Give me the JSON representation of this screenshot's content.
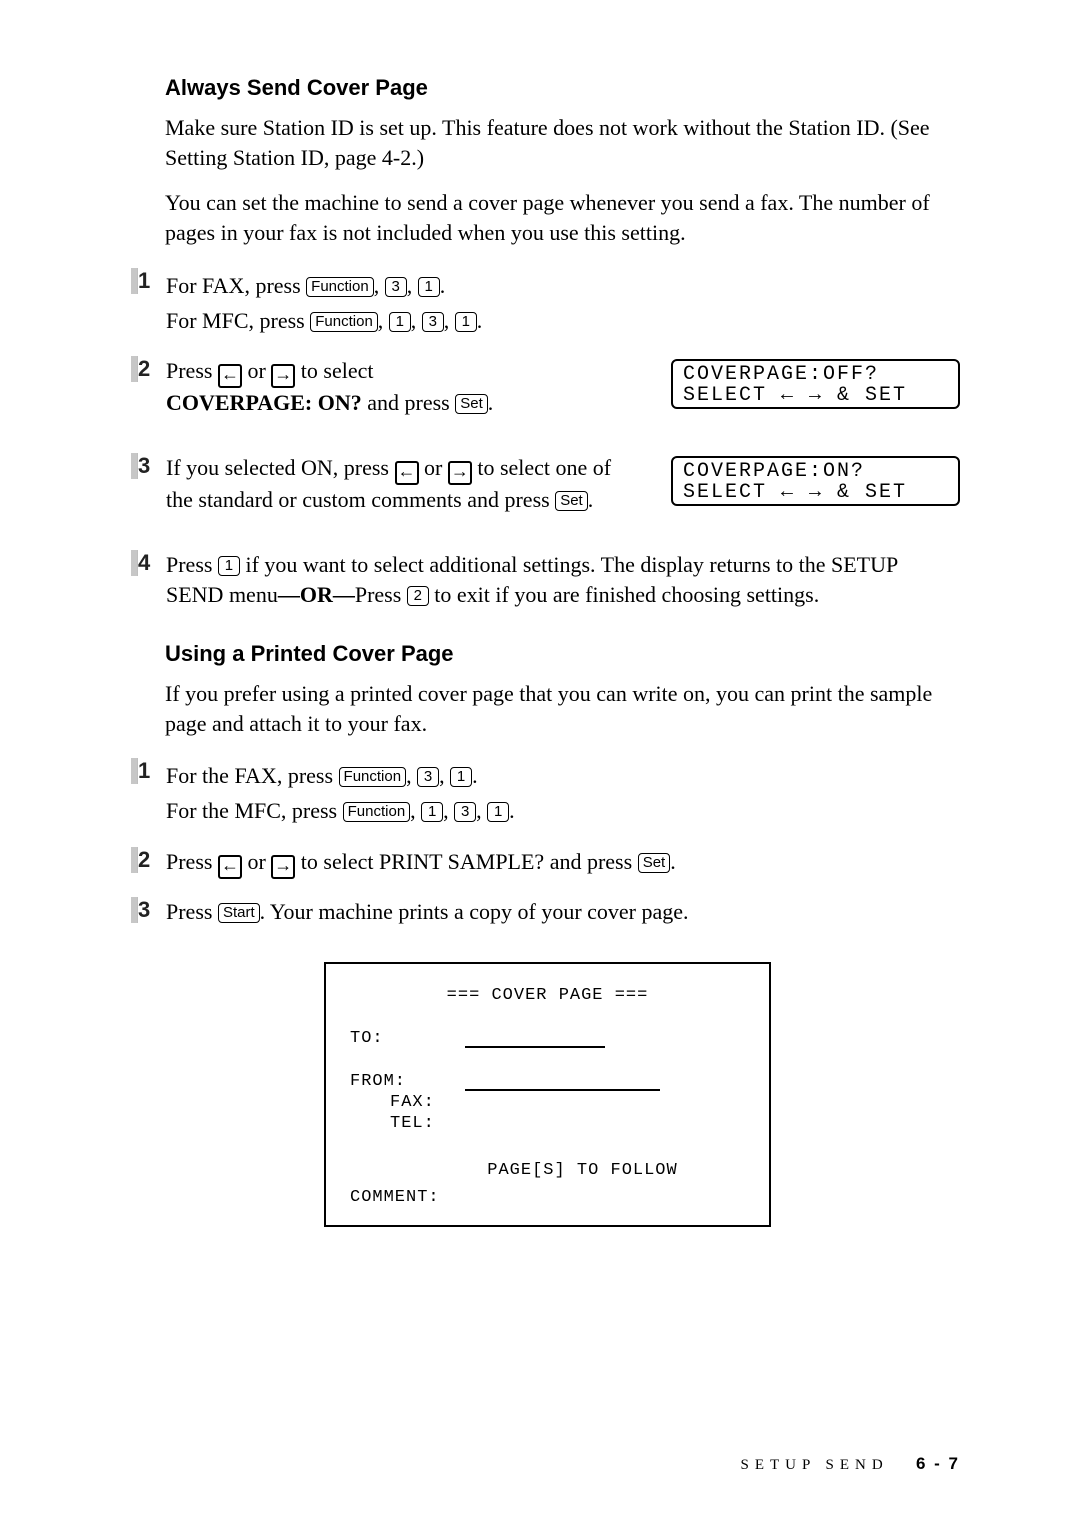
{
  "keys": {
    "function": "Function",
    "k1": "1",
    "k2": "2",
    "k3": "3",
    "set": "Set",
    "start": "Start",
    "left": "←",
    "right": "→"
  },
  "sec1": {
    "title": "Always Send Cover Page",
    "p1": "Make sure Station ID is set up. This feature does not work without the Station ID. (See Setting Station ID, page 4-2.)",
    "p2": "You can set the machine to send a cover page whenever you send a fax. The number of pages in your fax is not included when you use this setting.",
    "step1_a": "For FAX, press ",
    "step1_b": "For MFC, press ",
    "step2_a": "Press ",
    "step2_b": " or ",
    "step2_c": " to select ",
    "step2_d": "COVERPAGE: ON?",
    "step2_e": " and press ",
    "step3_a": "If you selected ON, press ",
    "step3_b": " or ",
    "step3_c": " to select one of the standard or custom comments and press ",
    "step4_a": "Press ",
    "step4_b": " if you want to select additional settings. The display returns to the SETUP SEND menu",
    "step4_or": "—OR—",
    "step4_c": "Press ",
    "step4_d": " to exit if you are finished choosing settings.",
    "lcd1_l1": "COVERPAGE:OFF?",
    "lcd1_l2": "SELECT ← → & SET",
    "lcd2_l1": "COVERPAGE:ON?",
    "lcd2_l2": "SELECT ← → & SET"
  },
  "sec2": {
    "title": "Using a Printed Cover Page",
    "p1": "If you prefer using a printed cover page that you can write on, you can print the sample page and attach it to your fax.",
    "step1_a": "For the FAX, press ",
    "step1_b": "For the MFC, press ",
    "step2_a": "Press ",
    "step2_b": " or ",
    "step2_c": " to select PRINT SAMPLE? and press ",
    "step3_a": "Press ",
    "step3_b": ". Your machine prints a copy of your cover page."
  },
  "sample": {
    "title": "=== COVER PAGE ===",
    "to": "TO:",
    "from": "FROM:",
    "fax": "FAX:",
    "tel": "TEL:",
    "pages": "PAGE[S] TO FOLLOW",
    "comment": "COMMENT:"
  },
  "footer": {
    "section": "SETUP SEND",
    "page": "6 - 7"
  }
}
